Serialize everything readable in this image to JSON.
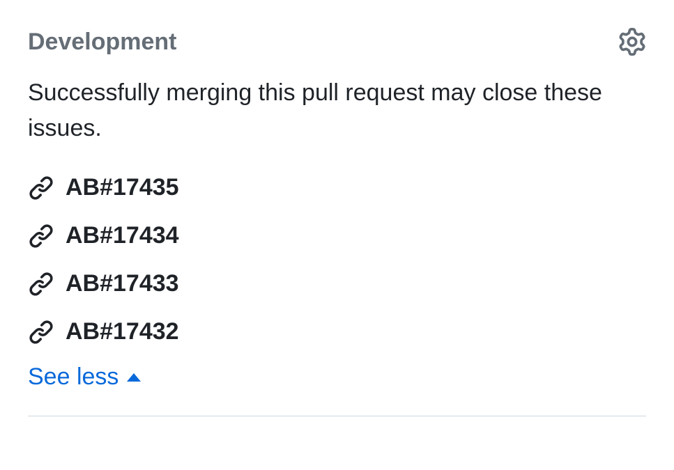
{
  "development": {
    "title": "Development",
    "description": "Successfully merging this pull request may close these issues.",
    "links": [
      {
        "label": "AB#17435"
      },
      {
        "label": "AB#17434"
      },
      {
        "label": "AB#17433"
      },
      {
        "label": "AB#17432"
      }
    ],
    "toggle_label": "See less"
  }
}
